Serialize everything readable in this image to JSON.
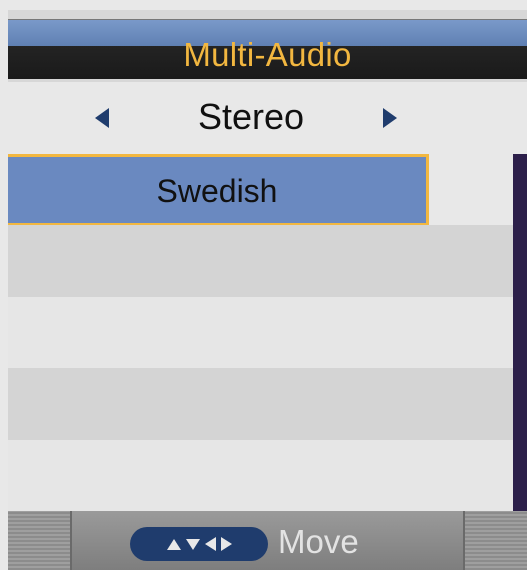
{
  "title": "Multi-Audio",
  "mode_selector": {
    "value": "Stereo",
    "prev_icon": "triangle-left",
    "next_icon": "triangle-right"
  },
  "audio_list": {
    "items": [
      "Swedish",
      "",
      "",
      "",
      ""
    ],
    "selected_index": 0
  },
  "footer": {
    "nav_icons": [
      "triangle-up",
      "triangle-down",
      "triangle-left",
      "triangle-right"
    ],
    "move_label": "Move"
  },
  "colors": {
    "accent": "#f2b740",
    "selected_row": "#6a89c0",
    "nav_button": "#1f3c6d",
    "scrollbar": "#2c1f4a"
  }
}
